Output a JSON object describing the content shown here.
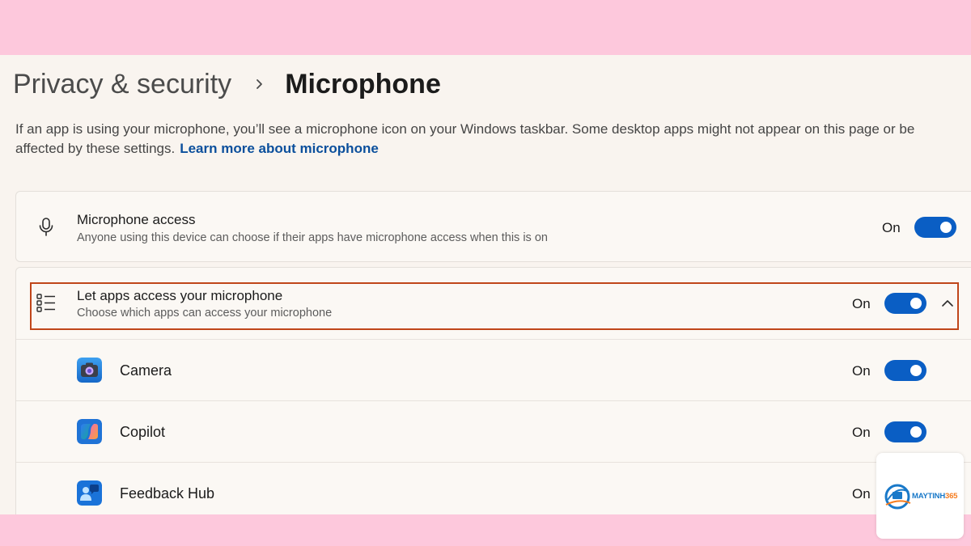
{
  "breadcrumb": {
    "parent": "Privacy & security",
    "current": "Microphone"
  },
  "description": {
    "text": "If an app is using your microphone, you’ll see a microphone icon on your Windows taskbar. Some desktop apps might not appear on this page or be affected by these settings.",
    "link": "Learn more about microphone"
  },
  "microphone_access": {
    "title": "Microphone access",
    "subtitle": "Anyone using this device can choose if their apps have microphone access when this is on",
    "state": "On",
    "enabled": true
  },
  "let_apps": {
    "title": "Let apps access your microphone",
    "subtitle": "Choose which apps can access your microphone",
    "state": "On",
    "enabled": true,
    "expanded": true
  },
  "apps": [
    {
      "name": "Camera",
      "state": "On",
      "icon": "camera-app-icon"
    },
    {
      "name": "Copilot",
      "state": "On",
      "icon": "copilot-app-icon"
    },
    {
      "name": "Feedback Hub",
      "state": "On",
      "icon": "feedback-hub-app-icon"
    }
  ],
  "watermark": {
    "brand_main": "MAYTINH",
    "brand_accent": "365"
  },
  "colors": {
    "accent": "#0a5ec4",
    "link": "#0b4f9c",
    "highlight": "#c0461a",
    "frame": "#fdc8dc"
  }
}
